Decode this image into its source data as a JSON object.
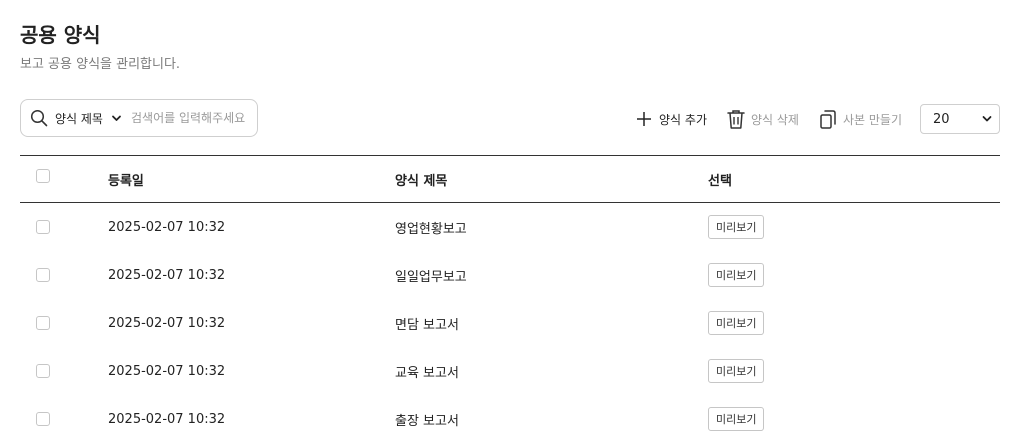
{
  "page": {
    "title": "공용 양식",
    "description": "보고 공용 양식을 관리합니다."
  },
  "search": {
    "field_select": "양식 제목",
    "placeholder": "검색어를 입력해주세요",
    "value": ""
  },
  "toolbar": {
    "add_label": "양식 추가",
    "delete_label": "양식 삭제",
    "copy_label": "사본 만들기",
    "page_size": "20"
  },
  "icons": {
    "search": "search-icon",
    "dropdown": "chevron-down-icon",
    "add": "plus-icon",
    "delete": "trash-icon",
    "copy": "copy-icon"
  },
  "colors": {
    "text": "#222222",
    "muted": "#9a9a9a",
    "border": "#cfcfcf",
    "rule": "#333333"
  },
  "table": {
    "columns": [
      "등록일",
      "양식 제목",
      "선택"
    ],
    "rows": [
      {
        "date": "2025-02-07 10:32",
        "title": "영업현황보고",
        "action": "미리보기"
      },
      {
        "date": "2025-02-07 10:32",
        "title": "일일업무보고",
        "action": "미리보기"
      },
      {
        "date": "2025-02-07 10:32",
        "title": "면담 보고서",
        "action": "미리보기"
      },
      {
        "date": "2025-02-07 10:32",
        "title": "교육 보고서",
        "action": "미리보기"
      },
      {
        "date": "2025-02-07 10:32",
        "title": "출장 보고서",
        "action": "미리보기"
      }
    ]
  }
}
